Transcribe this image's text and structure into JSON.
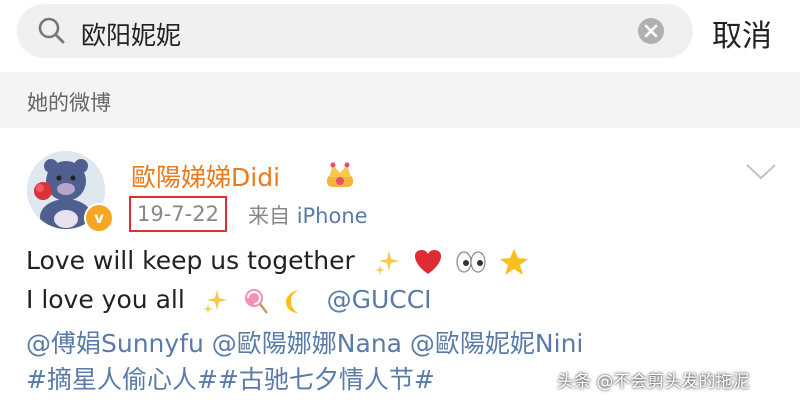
{
  "search": {
    "query": "欧阳妮妮",
    "cancel_label": "取消",
    "icons": {
      "search": "search-icon",
      "clear": "clear-icon"
    }
  },
  "section": {
    "title": "她的微博"
  },
  "post": {
    "username": "歐陽娣娣Didi",
    "date": "19-7-22",
    "source_prefix": "来自",
    "source_device": "iPhone",
    "line1": "Love will keep us together",
    "line2_text": "I love you all",
    "line2_mention": "@GUCCI",
    "line3": "@傅娟Sunnyfu @歐陽娜娜Nana @歐陽妮妮Nini",
    "line4": "#摘星人偷心人##古驰七夕情人节#",
    "icons": {
      "badge": "crown-icon",
      "verified": "verified-badge",
      "menu": "chevron-down-icon",
      "emoji_line1": [
        "sparkles-icon",
        "red-heart-icon",
        "eyes-icon",
        "star-icon"
      ],
      "emoji_line2": [
        "sparkles-icon",
        "lollipop-icon",
        "crescent-moon-icon"
      ]
    }
  },
  "watermark": "头条 @不会剪头发的拖泥",
  "colors": {
    "username": "#eb7a1b",
    "link": "#5a7ba8",
    "date_highlight": "#e0302d",
    "verified": "#f6a623"
  }
}
